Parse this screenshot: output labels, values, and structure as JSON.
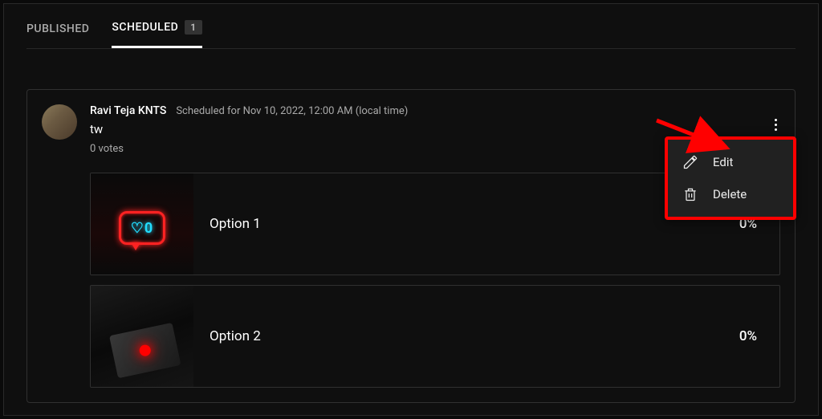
{
  "tabs": {
    "published": "PUBLISHED",
    "scheduled": "SCHEDULED",
    "scheduled_count": "1"
  },
  "post": {
    "author": "Ravi Teja KNTS",
    "schedule_text": "Scheduled for Nov 10, 2022, 12:00 AM (local time)",
    "title": "tw",
    "votes": "0 votes",
    "options": [
      {
        "label": "Option 1",
        "pct": "0%"
      },
      {
        "label": "Option 2",
        "pct": "0%"
      }
    ]
  },
  "menu": {
    "edit": "Edit",
    "delete": "Delete"
  },
  "thumb1": {
    "text": "♡0"
  }
}
